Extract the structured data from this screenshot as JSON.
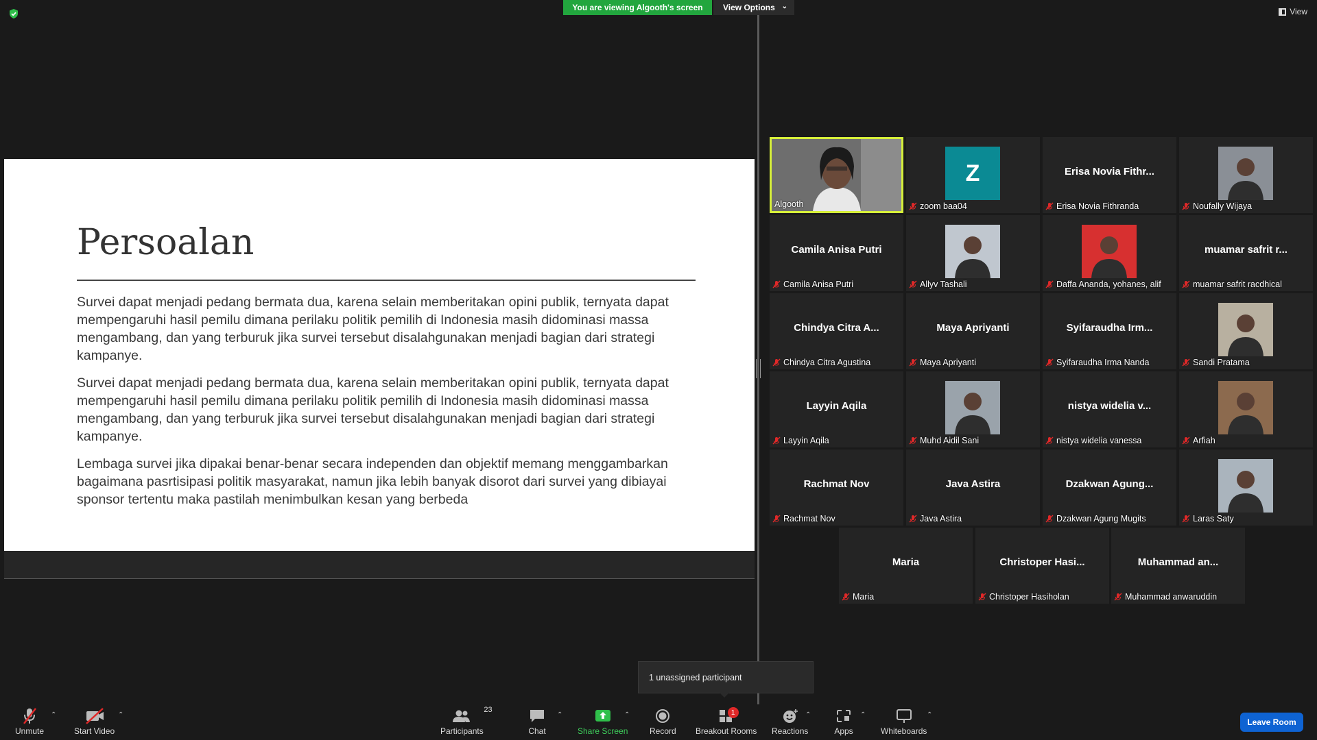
{
  "banner": {
    "viewing_text": "You are viewing Algooth's screen",
    "view_options_label": "View Options",
    "view_label": "View"
  },
  "slide": {
    "title": "Persoalan",
    "paragraphs": [
      "Survei dapat menjadi pedang bermata dua, karena selain memberitakan opini publik, ternyata dapat mempengaruhi hasil pemilu dimana perilaku politik pemilih di Indonesia masih didominasi massa mengambang, dan yang terburuk jika survei tersebut disalahgunakan menjadi bagian dari strategi kampanye.",
      "Survei dapat menjadi pedang bermata dua, karena selain memberitakan opini publik, ternyata dapat mempengaruhi hasil pemilu dimana perilaku politik pemilih di Indonesia masih didominasi massa mengambang, dan yang terburuk jika survei tersebut disalahgunakan menjadi bagian dari strategi kampanye.",
      "Lembaga survei jika dipakai benar-benar secara independen dan objektif memang menggambarkan bagaimana pasrtisipasi politik masyarakat, namun jika lebih banyak disorot dari survei yang dibiayai sponsor tertentu maka pastilah menimbulkan kesan yang berbeda"
    ]
  },
  "participants": [
    {
      "name": "Algooth",
      "display": "",
      "kind": "video",
      "active": true,
      "muted": false
    },
    {
      "name": "zoom baa04",
      "display": "",
      "kind": "avatar",
      "avatar_letter": "Z",
      "muted": true
    },
    {
      "name": "Erisa Novia Fithranda",
      "display": "Erisa Novia Fithr...",
      "kind": "text",
      "muted": true
    },
    {
      "name": "Noufally Wijaya",
      "display": "",
      "kind": "photo",
      "muted": true
    },
    {
      "name": "Camila Anisa Putri",
      "display": "Camila Anisa Putri",
      "kind": "text",
      "muted": true
    },
    {
      "name": "Allyv Tashali",
      "display": "",
      "kind": "photo",
      "muted": true
    },
    {
      "name": "Daffa Ananda, yohanes, alif",
      "display": "",
      "kind": "photo",
      "muted": true
    },
    {
      "name": "muamar safrit racdhical",
      "display": "muamar safrit r...",
      "kind": "text",
      "muted": true
    },
    {
      "name": "Chindya Citra Agustina",
      "display": "Chindya Citra A...",
      "kind": "text",
      "muted": true
    },
    {
      "name": "Maya Apriyanti",
      "display": "Maya Apriyanti",
      "kind": "text",
      "muted": true
    },
    {
      "name": "Syifaraudha Irma Nanda",
      "display": "Syifaraudha Irm...",
      "kind": "text",
      "muted": true
    },
    {
      "name": "Sandi Pratama",
      "display": "",
      "kind": "photo",
      "muted": true
    },
    {
      "name": "Layyin Aqila",
      "display": "Layyin Aqila",
      "kind": "text",
      "muted": true
    },
    {
      "name": "Muhd Aidil Sani",
      "display": "",
      "kind": "photo",
      "muted": true
    },
    {
      "name": "nistya widelia vanessa",
      "display": "nistya widelia v...",
      "kind": "text",
      "muted": true
    },
    {
      "name": "Arfiah",
      "display": "",
      "kind": "photo",
      "muted": true
    },
    {
      "name": "Rachmat Nov",
      "display": "Rachmat Nov",
      "kind": "text",
      "muted": true
    },
    {
      "name": "Java Astira",
      "display": "Java Astira",
      "kind": "text",
      "muted": true
    },
    {
      "name": "Dzakwan Agung Mugits",
      "display": "Dzakwan Agung...",
      "kind": "text",
      "muted": true
    },
    {
      "name": "Laras Saty",
      "display": "",
      "kind": "photo",
      "muted": true
    },
    {
      "name": "Maria",
      "display": "Maria",
      "kind": "text",
      "muted": true
    },
    {
      "name": "Christoper Hasiholan",
      "display": "Christoper Hasi...",
      "kind": "text",
      "muted": true
    },
    {
      "name": "Muhammad anwaruddin",
      "display": "Muhammad an...",
      "kind": "text",
      "muted": true
    }
  ],
  "tooltip": {
    "text": "1 unassigned participant"
  },
  "toolbar": {
    "unmute": "Unmute",
    "start_video": "Start Video",
    "participants": "Participants",
    "participants_count": "23",
    "chat": "Chat",
    "share_screen": "Share Screen",
    "record": "Record",
    "breakout_rooms": "Breakout Rooms",
    "breakout_badge": "1",
    "reactions": "Reactions",
    "apps": "Apps",
    "whiteboards": "Whiteboards",
    "leave_room": "Leave Room"
  },
  "colors": {
    "banner_green": "#22a63e",
    "active_border": "#d6ef3a",
    "leave_blue": "#0e63d3",
    "muted_red": "#e02828",
    "avatar_teal": "#0b8a94"
  }
}
